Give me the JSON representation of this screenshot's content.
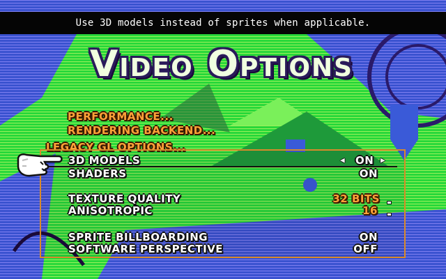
{
  "tooltip": "Use 3D models instead of sprites when applicable.",
  "title": "Video Options",
  "menu": {
    "performance": "Performance...",
    "rendering_backend": "Rendering Backend...",
    "legacy_gl": "Legacy GL Options..."
  },
  "options": [
    {
      "label": "3D Models",
      "value": "On",
      "selected": true
    },
    {
      "label": "Shaders",
      "value": "On"
    },
    {
      "label": "Texture Quality",
      "value": "32 bits"
    },
    {
      "label": "Anisotropic",
      "value": "16"
    },
    {
      "label": "Sprite Billboarding",
      "value": "On"
    },
    {
      "label": "Software Perspective",
      "value": "Off"
    }
  ],
  "icons": {
    "cursor": "pointing-hand-icon",
    "left_arrow": "arrow-left-icon",
    "right_arrow": "arrow-right-icon"
  },
  "colors": {
    "menu_orange": "#ffa238",
    "panel_border": "#d98a2a",
    "bg_green": "#22dd22",
    "bg_blue": "#3a5ad8"
  }
}
